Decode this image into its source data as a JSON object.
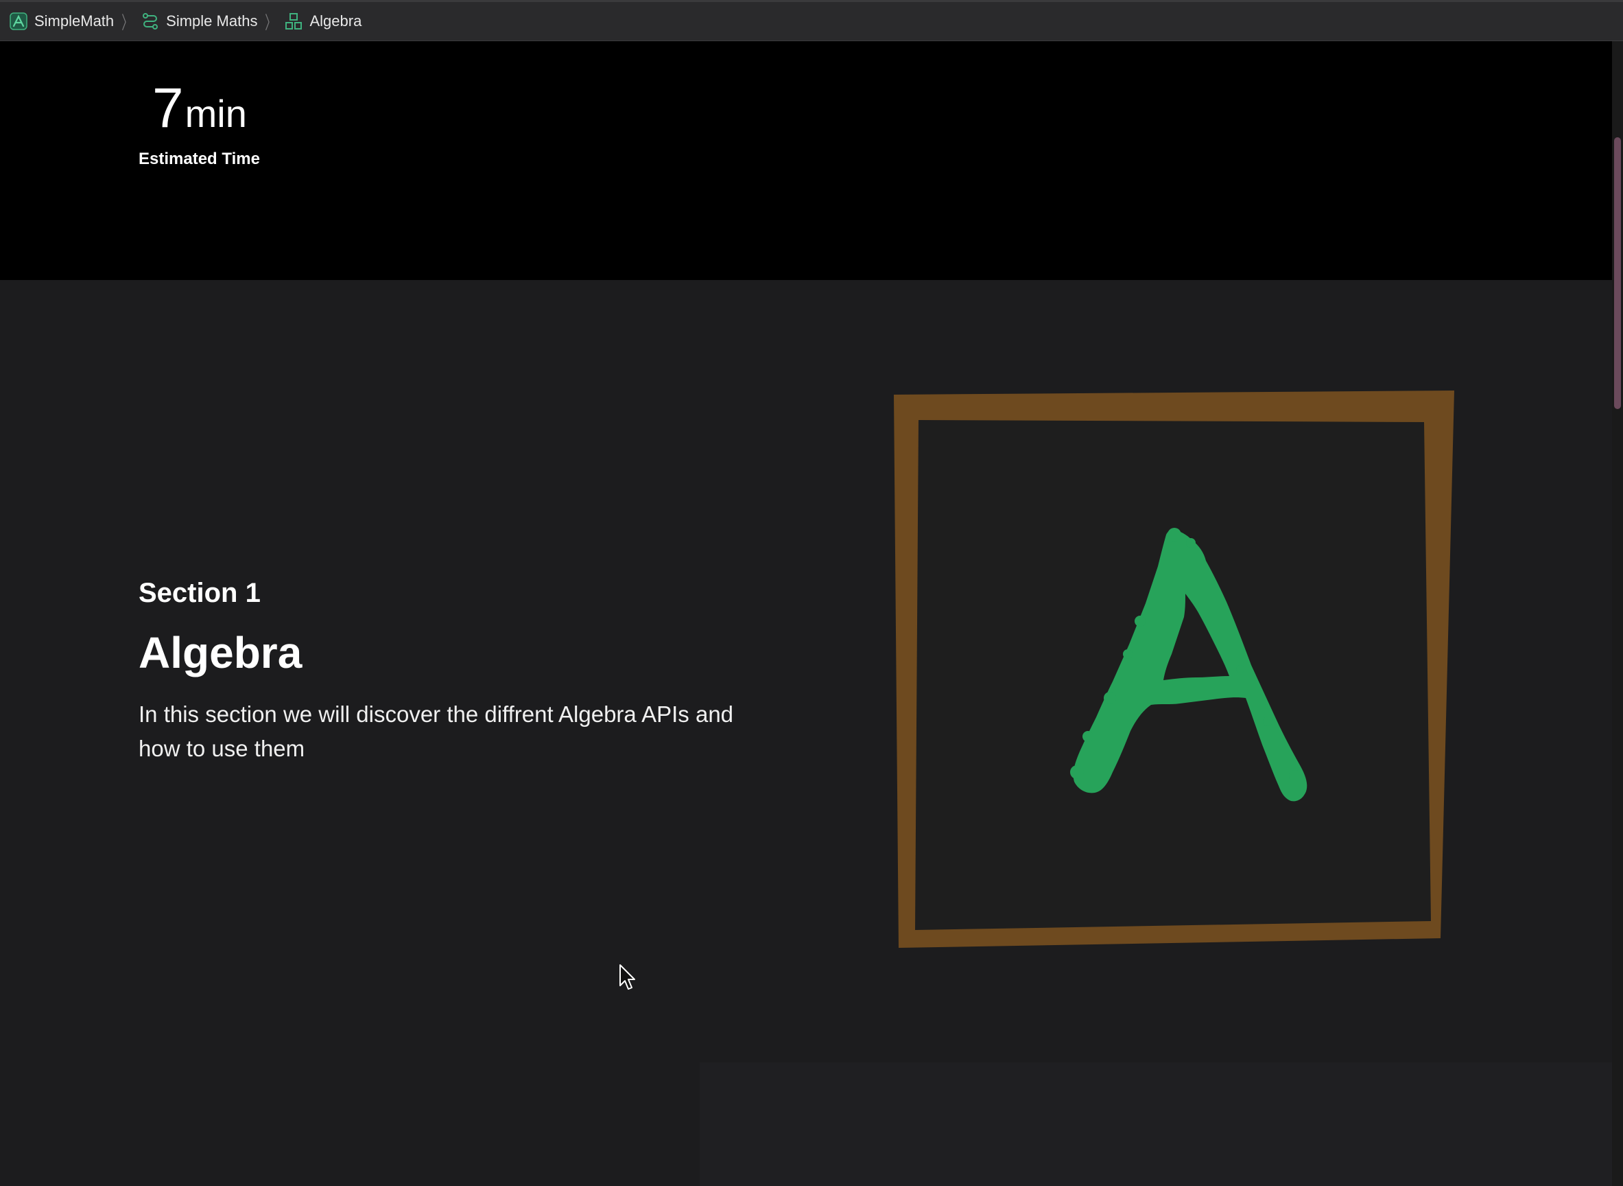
{
  "breadcrumb": {
    "items": [
      {
        "label": "SimpleMath",
        "icon": "app-icon"
      },
      {
        "label": "Simple Maths",
        "icon": "tutorial-icon"
      },
      {
        "label": "Algebra",
        "icon": "section-icon"
      }
    ]
  },
  "header": {
    "time_value": "7",
    "time_unit": "min",
    "time_label": "Estimated Time"
  },
  "section": {
    "eyebrow": "Section 1",
    "title": "Algebra",
    "description": "In this section we will discover the diffrent Algebra APIs and how to use them"
  },
  "illustration": {
    "name": "chalkboard-letter-a",
    "letter_color": "#27a35a",
    "frame_color": "#6e4a1f",
    "board_color": "#1e1e1e"
  },
  "colors": {
    "header_background": "#000000",
    "page_background": "#1c1c1e",
    "accent_green": "#2fa66a",
    "scrollbar_thumb": "#6b4a5c"
  }
}
